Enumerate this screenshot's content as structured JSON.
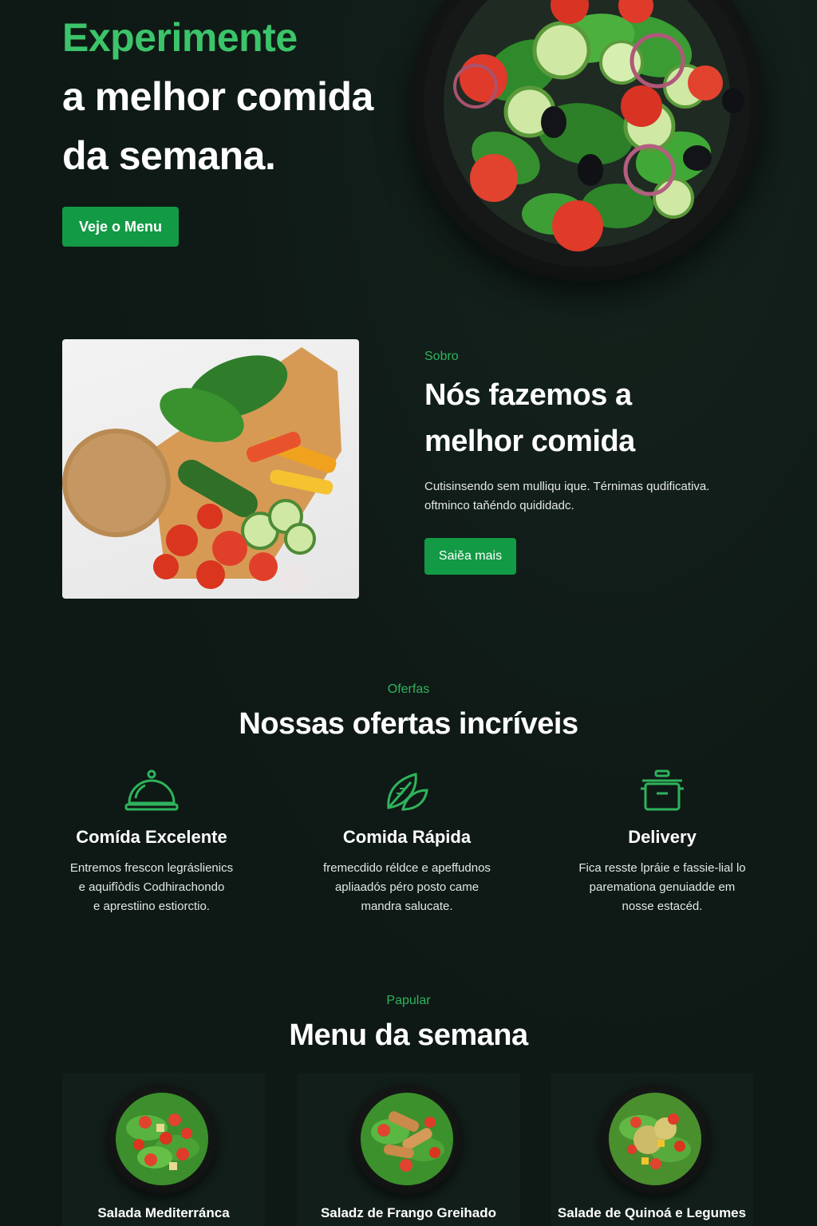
{
  "hero": {
    "title_accent": "Experimente",
    "title_line1": "a melhor comida",
    "title_line2": "da semana.",
    "cta_label": "Veje o Menu"
  },
  "about": {
    "eyebrow": "Sobro",
    "heading_line1": "Nós fazemos a",
    "heading_line2": "melhor comida",
    "text_line1": "Cutisinsendo sem mulliqu ique. Térnimas qudificativa.",
    "text_line2": "oftminco taňéndo quididadc.",
    "cta_label": "Saiěa mais"
  },
  "offers": {
    "eyebrow": "Oferfas",
    "title": "Nossas ofertas incríveis",
    "items": [
      {
        "icon": "cloche-icon",
        "title": "Comída Excelente",
        "lines": [
          "Entremos frescon legráslienics",
          "e aquifîòdis Codhirachondo",
          "e aprestiino estiorctio."
        ]
      },
      {
        "icon": "leaf-icon",
        "title": "Comida Rápida",
        "lines": [
          "fremecdido réldce e apeffudnos",
          "apliaadós péro posto came",
          "mandra salucate."
        ]
      },
      {
        "icon": "pot-icon",
        "title": "Delivery",
        "lines": [
          "Fica resste lpráie e fassie-lial lo",
          "paremationa genuiadde em",
          "nosse estacéd."
        ]
      }
    ]
  },
  "menu": {
    "eyebrow": "Papular",
    "title": "Menu da semana",
    "items": [
      {
        "name": "Salada Mediterránca"
      },
      {
        "name": "Saladz de Frango Greihado"
      },
      {
        "name": "Salade de Quinoá e Legumes"
      }
    ]
  },
  "colors": {
    "accent": "#3cc46a",
    "button": "#139a45",
    "background": "#0f1a16"
  }
}
